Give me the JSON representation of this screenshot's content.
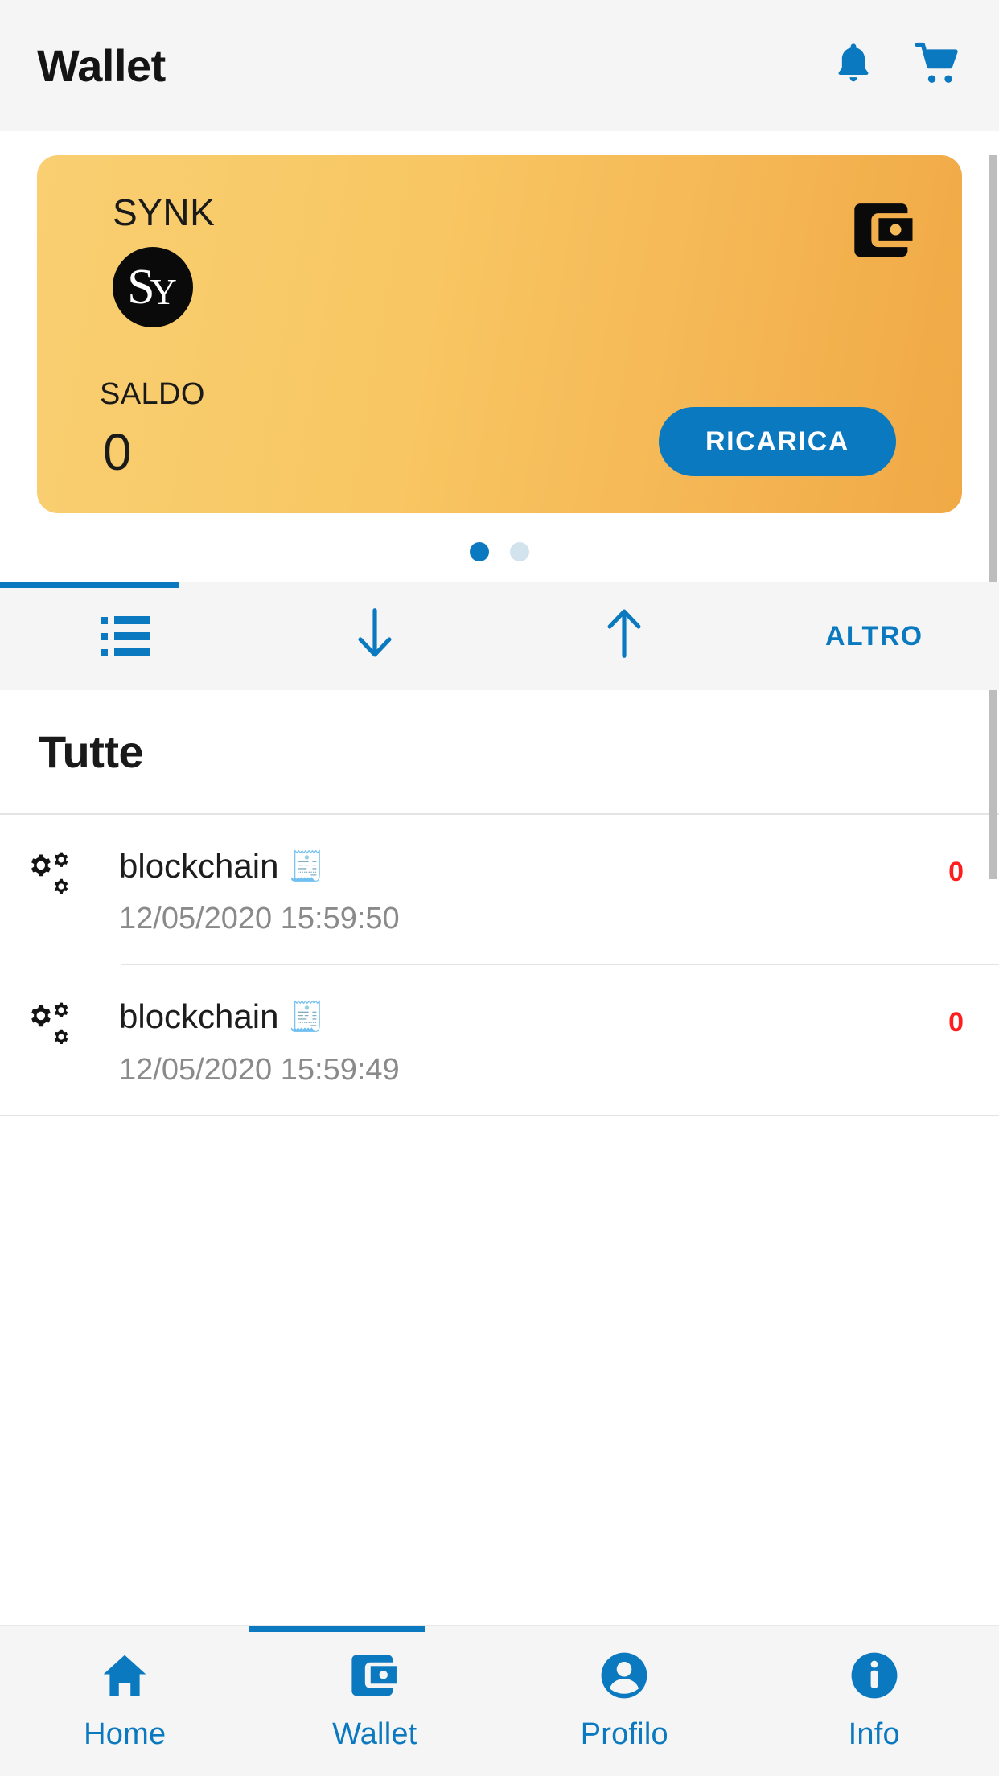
{
  "appbar": {
    "title": "Wallet",
    "actions": [
      {
        "icon": "bell-icon",
        "name": "notifications-button"
      },
      {
        "icon": "cart-icon",
        "name": "cart-button"
      }
    ]
  },
  "card": {
    "brand": "SYNK",
    "logo_text": "SY",
    "logo_s": "S",
    "logo_y": "Y",
    "balance_label": "SALDO",
    "balance_value": "0",
    "action_label": "RICARICA",
    "wallet_icon": "wallet-icon",
    "gradient_from": "#f9cf72",
    "gradient_to": "#f0a945",
    "action_color": "#0b79bf"
  },
  "carousel": {
    "dots": [
      {
        "state": "active"
      },
      {
        "state": "inactive"
      }
    ],
    "active_index": 0,
    "active_color": "#0b79bf",
    "inactive_color": "#d3e3ee"
  },
  "segment_tabs": {
    "active_index": 0,
    "accent": "#0b79bf",
    "items": [
      {
        "label": "",
        "icon": "list-icon",
        "name": "tab-all"
      },
      {
        "label": "",
        "icon": "arrow-down-icon",
        "name": "tab-incoming"
      },
      {
        "label": "",
        "icon": "arrow-up-icon",
        "name": "tab-outgoing"
      },
      {
        "label": "ALTRO",
        "icon": "",
        "name": "tab-altro"
      }
    ]
  },
  "section": {
    "title": "Tutte"
  },
  "transactions": [
    {
      "icon": "cogs-icon",
      "title": "blockchain",
      "badge": "🧾",
      "date": "12/05/2020 15:59:50",
      "amount": "0",
      "amount_color": "#ff1d1d"
    },
    {
      "icon": "cogs-icon",
      "title": "blockchain",
      "badge": "🧾",
      "date": "12/05/2020 15:59:49",
      "amount": "0",
      "amount_color": "#ff1d1d"
    }
  ],
  "bottom_nav": {
    "active_index": 1,
    "accent": "#0b79bf",
    "items": [
      {
        "label": "Home",
        "icon": "home-icon",
        "name": "nav-home"
      },
      {
        "label": "Wallet",
        "icon": "wallet-icon",
        "name": "nav-wallet"
      },
      {
        "label": "Profilo",
        "icon": "person-icon",
        "name": "nav-profilo"
      },
      {
        "label": "Info",
        "icon": "info-icon",
        "name": "nav-info"
      }
    ]
  },
  "scrollbar": {
    "color": "#bdbdbd"
  }
}
